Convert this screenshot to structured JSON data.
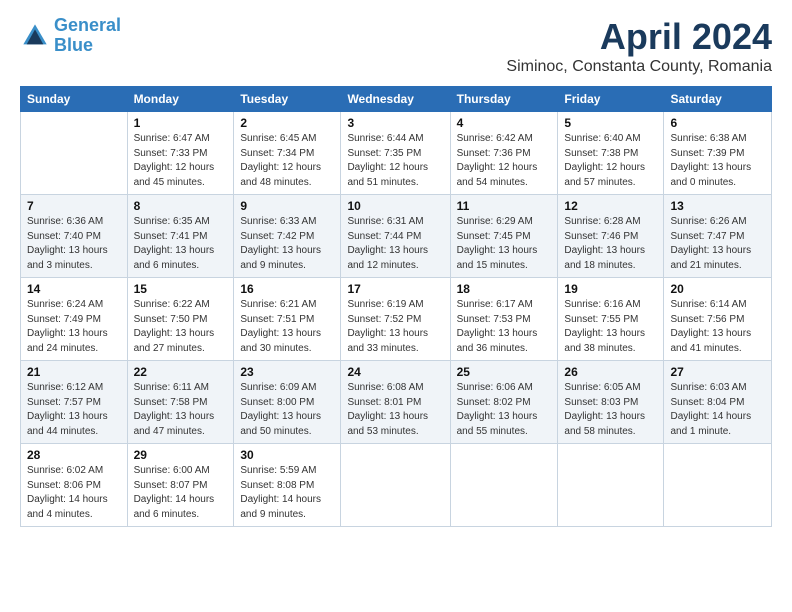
{
  "header": {
    "logo_line1": "General",
    "logo_line2": "Blue",
    "title": "April 2024",
    "subtitle": "Siminoc, Constanta County, Romania"
  },
  "weekdays": [
    "Sunday",
    "Monday",
    "Tuesday",
    "Wednesday",
    "Thursday",
    "Friday",
    "Saturday"
  ],
  "weeks": [
    [
      {
        "day": "",
        "info": ""
      },
      {
        "day": "1",
        "info": "Sunrise: 6:47 AM\nSunset: 7:33 PM\nDaylight: 12 hours\nand 45 minutes."
      },
      {
        "day": "2",
        "info": "Sunrise: 6:45 AM\nSunset: 7:34 PM\nDaylight: 12 hours\nand 48 minutes."
      },
      {
        "day": "3",
        "info": "Sunrise: 6:44 AM\nSunset: 7:35 PM\nDaylight: 12 hours\nand 51 minutes."
      },
      {
        "day": "4",
        "info": "Sunrise: 6:42 AM\nSunset: 7:36 PM\nDaylight: 12 hours\nand 54 minutes."
      },
      {
        "day": "5",
        "info": "Sunrise: 6:40 AM\nSunset: 7:38 PM\nDaylight: 12 hours\nand 57 minutes."
      },
      {
        "day": "6",
        "info": "Sunrise: 6:38 AM\nSunset: 7:39 PM\nDaylight: 13 hours\nand 0 minutes."
      }
    ],
    [
      {
        "day": "7",
        "info": "Sunrise: 6:36 AM\nSunset: 7:40 PM\nDaylight: 13 hours\nand 3 minutes."
      },
      {
        "day": "8",
        "info": "Sunrise: 6:35 AM\nSunset: 7:41 PM\nDaylight: 13 hours\nand 6 minutes."
      },
      {
        "day": "9",
        "info": "Sunrise: 6:33 AM\nSunset: 7:42 PM\nDaylight: 13 hours\nand 9 minutes."
      },
      {
        "day": "10",
        "info": "Sunrise: 6:31 AM\nSunset: 7:44 PM\nDaylight: 13 hours\nand 12 minutes."
      },
      {
        "day": "11",
        "info": "Sunrise: 6:29 AM\nSunset: 7:45 PM\nDaylight: 13 hours\nand 15 minutes."
      },
      {
        "day": "12",
        "info": "Sunrise: 6:28 AM\nSunset: 7:46 PM\nDaylight: 13 hours\nand 18 minutes."
      },
      {
        "day": "13",
        "info": "Sunrise: 6:26 AM\nSunset: 7:47 PM\nDaylight: 13 hours\nand 21 minutes."
      }
    ],
    [
      {
        "day": "14",
        "info": "Sunrise: 6:24 AM\nSunset: 7:49 PM\nDaylight: 13 hours\nand 24 minutes."
      },
      {
        "day": "15",
        "info": "Sunrise: 6:22 AM\nSunset: 7:50 PM\nDaylight: 13 hours\nand 27 minutes."
      },
      {
        "day": "16",
        "info": "Sunrise: 6:21 AM\nSunset: 7:51 PM\nDaylight: 13 hours\nand 30 minutes."
      },
      {
        "day": "17",
        "info": "Sunrise: 6:19 AM\nSunset: 7:52 PM\nDaylight: 13 hours\nand 33 minutes."
      },
      {
        "day": "18",
        "info": "Sunrise: 6:17 AM\nSunset: 7:53 PM\nDaylight: 13 hours\nand 36 minutes."
      },
      {
        "day": "19",
        "info": "Sunrise: 6:16 AM\nSunset: 7:55 PM\nDaylight: 13 hours\nand 38 minutes."
      },
      {
        "day": "20",
        "info": "Sunrise: 6:14 AM\nSunset: 7:56 PM\nDaylight: 13 hours\nand 41 minutes."
      }
    ],
    [
      {
        "day": "21",
        "info": "Sunrise: 6:12 AM\nSunset: 7:57 PM\nDaylight: 13 hours\nand 44 minutes."
      },
      {
        "day": "22",
        "info": "Sunrise: 6:11 AM\nSunset: 7:58 PM\nDaylight: 13 hours\nand 47 minutes."
      },
      {
        "day": "23",
        "info": "Sunrise: 6:09 AM\nSunset: 8:00 PM\nDaylight: 13 hours\nand 50 minutes."
      },
      {
        "day": "24",
        "info": "Sunrise: 6:08 AM\nSunset: 8:01 PM\nDaylight: 13 hours\nand 53 minutes."
      },
      {
        "day": "25",
        "info": "Sunrise: 6:06 AM\nSunset: 8:02 PM\nDaylight: 13 hours\nand 55 minutes."
      },
      {
        "day": "26",
        "info": "Sunrise: 6:05 AM\nSunset: 8:03 PM\nDaylight: 13 hours\nand 58 minutes."
      },
      {
        "day": "27",
        "info": "Sunrise: 6:03 AM\nSunset: 8:04 PM\nDaylight: 14 hours\nand 1 minute."
      }
    ],
    [
      {
        "day": "28",
        "info": "Sunrise: 6:02 AM\nSunset: 8:06 PM\nDaylight: 14 hours\nand 4 minutes."
      },
      {
        "day": "29",
        "info": "Sunrise: 6:00 AM\nSunset: 8:07 PM\nDaylight: 14 hours\nand 6 minutes."
      },
      {
        "day": "30",
        "info": "Sunrise: 5:59 AM\nSunset: 8:08 PM\nDaylight: 14 hours\nand 9 minutes."
      },
      {
        "day": "",
        "info": ""
      },
      {
        "day": "",
        "info": ""
      },
      {
        "day": "",
        "info": ""
      },
      {
        "day": "",
        "info": ""
      }
    ]
  ]
}
